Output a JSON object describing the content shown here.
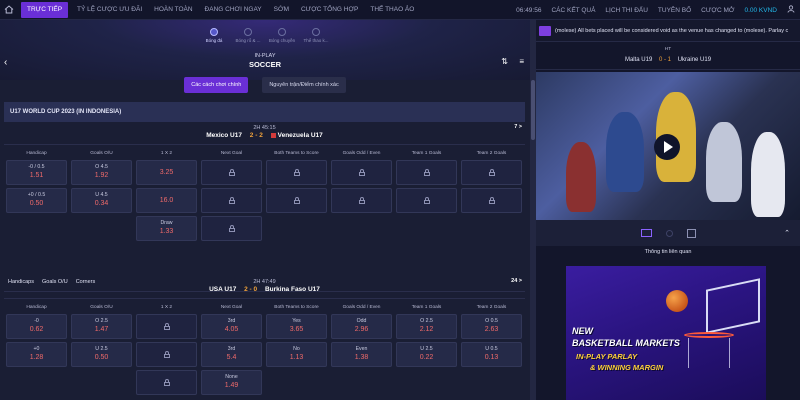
{
  "nav": {
    "items": [
      "TRỰC TIẾP",
      "TỶ LỆ CƯỢC ƯU ĐÃI",
      "HOÀN TOÀN",
      "ĐANG CHƠI NGAY",
      "SỚM",
      "CƯỢC TỔNG HỢP",
      "THỂ THAO ẢO"
    ],
    "time": "06:49:56",
    "right_items": [
      "CÁC KẾT QUẢ",
      "LỊCH THI ĐẤU",
      "TUYÊN BỐ",
      "CƯỢC MỞ"
    ],
    "balance": "0.00 KVND"
  },
  "hero": {
    "sports": [
      "Bóng đá",
      "Bóng rổ & ...",
      "Bóng chuyền",
      "Thể thao k..."
    ],
    "subtitle": "IN-PLAY",
    "title": "SOCCER"
  },
  "tabs": [
    "Các cách chơi chính",
    "Nguyên trận/Điểm chính xác"
  ],
  "league": "U17 WORLD CUP 2023 (IN INDONESIA)",
  "headers": [
    "Handicap",
    "Goals O/U",
    "1 X 2",
    "Next Goal",
    "Both Teams to Score",
    "Goals Odd / Even",
    "Team 1 Goals",
    "Team 2 Goals"
  ],
  "match1": {
    "time": "2H  45:15",
    "home": "Mexico U17",
    "score_home": "2",
    "score_away": "2",
    "away": "Venezuela U17",
    "more": "7 >",
    "handicap": [
      {
        "line": "-0 / 0.5",
        "odds": "1.51"
      },
      {
        "line": "+0 / 0.5",
        "odds": "0.50"
      }
    ],
    "goals": [
      {
        "line": "O 4.5",
        "odds": "1.92"
      },
      {
        "line": "U 4.5",
        "odds": "0.34"
      }
    ],
    "x12": [
      {
        "line": "",
        "odds": "3.25"
      },
      {
        "line": "",
        "odds": "16.0"
      },
      {
        "line": "Draw",
        "odds": "1.33"
      }
    ]
  },
  "subtabs": [
    "Handicaps",
    "Goals O/U",
    "Corners"
  ],
  "match2": {
    "time": "2H  47:49",
    "home": "USA U17",
    "score_home": "2",
    "score_away": "0",
    "away": "Burkina Faso U17",
    "more": "24 >",
    "handicap": [
      {
        "line": "-0",
        "odds": "0.62"
      },
      {
        "line": "+0",
        "odds": "1.28"
      }
    ],
    "goals": [
      {
        "line": "O 2.5",
        "odds": "1.47"
      },
      {
        "line": "U 2.5",
        "odds": "0.50"
      }
    ],
    "next_goal": [
      {
        "line": "3rd",
        "odds": "4.05"
      },
      {
        "line": "3rd",
        "odds": "5.4"
      },
      {
        "line": "None",
        "odds": "1.49"
      }
    ],
    "btts": [
      {
        "line": "Yes",
        "odds": "3.65"
      },
      {
        "line": "No",
        "odds": "1.13"
      }
    ],
    "odd_even": [
      {
        "line": "Odd",
        "odds": "2.96"
      },
      {
        "line": "Even",
        "odds": "1.38"
      }
    ],
    "team1": [
      {
        "line": "O 2.5",
        "odds": "2.12"
      },
      {
        "line": "U 2.5",
        "odds": "0.22"
      }
    ],
    "team2": [
      {
        "line": "O 0.5",
        "odds": "2.63"
      },
      {
        "line": "U 0.5",
        "odds": "0.13"
      }
    ]
  },
  "sidebar": {
    "ticker": "(molese) All bets placed will be considered void as the venue has changed to (molese). Parlay c",
    "period": "HT",
    "home": "Malta U19",
    "score_home": "0",
    "score_away": "1",
    "away": "Ukraine U19",
    "info_title": "Thông tin liên quan",
    "promo": [
      "NEW",
      "BASKETBALL MARKETS",
      "IN-PLAY PARLAY",
      "& WINNING MARGIN"
    ]
  },
  "colors": {
    "accent": "#6a2fd6",
    "odds": "#ef6a6a",
    "score": "#f2a33a",
    "balance": "#22b7e8"
  }
}
